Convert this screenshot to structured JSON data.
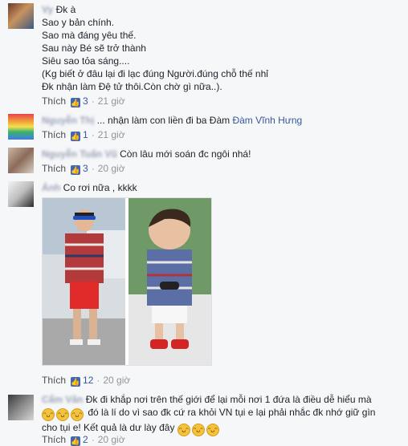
{
  "comments": [
    {
      "name": "Vy",
      "lines": [
        "Đk à",
        "Sao y bản chính.",
        "Sao mà đáng yêu thế.",
        "Sau này Bé sẽ trở thành",
        "Siêu sao tỏa sáng....",
        "(Kg biết ở đâu lại đi lạc đúng Người.đúng chỗ thế nhỉ",
        "Đk nhận làm Đệ tử thôi.Còn chờ gì nữa..)."
      ],
      "like_label": "Thích",
      "likes": "3",
      "time": "21 giờ"
    },
    {
      "name": "Nguyễn Thị",
      "text": "... nhận làm con liền đi ba Đàm",
      "mention": "Đàm Vĩnh Hưng",
      "like_label": "Thích",
      "likes": "1",
      "time": "21 giờ"
    },
    {
      "name": "Nguyễn Tuấn Vũ",
      "text": "Còn lâu mới soán đc ngôi nhá!",
      "like_label": "Thích",
      "likes": "3",
      "time": "20 giờ"
    },
    {
      "name": "Ánh",
      "text": "Co rơi nữa , kkkk",
      "like_label": "Thích",
      "likes": "12",
      "time": "20 giờ"
    },
    {
      "name": "Cẩm Vân",
      "lines": [
        "Đk đi khắp nơi trên thế giới để lại mỗi nơi 1 đứa là điều dễ hiểu mà",
        "đó là lí do vì sao đk cứ ra khỏi VN tụi e lại phải nhắc đk nhớ giữ gìn",
        "cho tụi e! Kết quả là dư lày đây"
      ],
      "like_label": "Thích",
      "likes": "2",
      "time": "20 giờ"
    }
  ],
  "colors": {
    "link": "#365899",
    "like_blue": "#4267b2",
    "meta": "#90949c"
  }
}
